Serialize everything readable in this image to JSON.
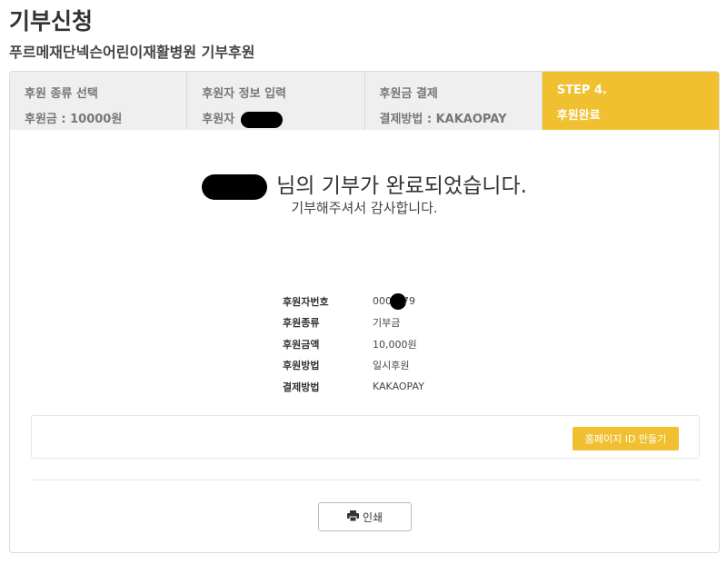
{
  "page": {
    "title": "기부신청",
    "subtitle": "푸르메재단넥슨어린이재활병원 기부후원"
  },
  "steps": [
    {
      "title": "후원 종류 선택",
      "value": "후원금 : 10000원"
    },
    {
      "title": "후원자 정보 입력",
      "value": "후원자"
    },
    {
      "title": "후원금 결제",
      "value": "결제방법 : KAKAOPAY"
    },
    {
      "title": "STEP 4.",
      "value": "후원완료"
    }
  ],
  "message": {
    "headline": "님의 기부가 완료되었습니다.",
    "subline": "기부해주셔서 감사합니다."
  },
  "info": {
    "donor_no_label": "후원자번호",
    "donor_no_prefix": "000",
    "donor_no_suffix": "79",
    "type_label": "후원종류",
    "type_value": "기부금",
    "amount_label": "후원금액",
    "amount_value": "10,000원",
    "method_label": "후원방법",
    "method_value": "일시후원",
    "payment_label": "결제방법",
    "payment_value": "KAKAOPAY"
  },
  "buttons": {
    "homepage_id": "홈페이지 ID 만들기",
    "print": "인쇄"
  },
  "icons": {
    "print": "printer-icon"
  },
  "colors": {
    "accent": "#f0c030",
    "step_inactive_bg": "#efefef"
  }
}
